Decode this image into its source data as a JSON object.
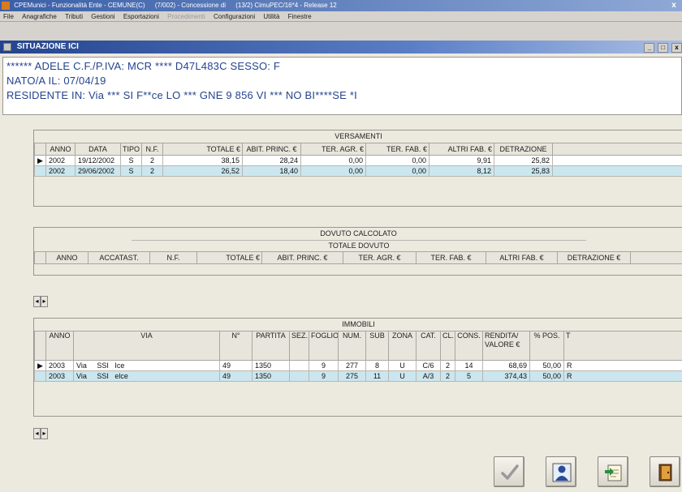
{
  "app": {
    "title_segments": [
      "CPEMunici - Funzionalità Ente - CEMUNE(C)",
      "(7/002) - Concessione di",
      "(13/2) CimuPEC/16*4 - Release 12"
    ],
    "menu": [
      {
        "label": "File",
        "disabled": false
      },
      {
        "label": "Anagrafiche",
        "disabled": false
      },
      {
        "label": "Tributi",
        "disabled": false
      },
      {
        "label": "Gestioni",
        "disabled": false
      },
      {
        "label": "Esportazioni",
        "disabled": false
      },
      {
        "label": "Procedimenti",
        "disabled": true
      },
      {
        "label": "Configurazioni",
        "disabled": false
      },
      {
        "label": "Utilità",
        "disabled": false
      },
      {
        "label": "Finestre",
        "disabled": false
      }
    ]
  },
  "window": {
    "title": "SITUAZIONE ICI",
    "controls": [
      "_",
      "□",
      "x"
    ]
  },
  "person": {
    "line1": "****** ADELE     C.F./P.IVA: MCR **** D47L483C     SESSO: F",
    "line2": "NATO/A IL: 07/04/19",
    "line3": "RESIDENTE IN: Via     *** SI F**ce LO *** GNE  9     856 VI *** NO BI****SE *I"
  },
  "versamenti": {
    "title": "VERSAMENTI",
    "columns": [
      "ANNO",
      "DATA",
      "TIPO",
      "N.F.",
      "TOTALE €",
      "ABIT. PRINC. €",
      "TER. AGR. €",
      "TER. FAB. €",
      "ALTRI FAB. €",
      "DETRAZIONE"
    ],
    "rows": [
      {
        "anno": "2002",
        "data": "19/12/2002",
        "tipo": "S",
        "nf": "2",
        "totale": "38,15",
        "abit": "28,24",
        "ter_agr": "0,00",
        "ter_fab": "0,00",
        "altri": "9,91",
        "detrazione": "25,82"
      },
      {
        "anno": "2002",
        "data": "29/06/2002",
        "tipo": "S",
        "nf": "2",
        "totale": "26,52",
        "abit": "18,40",
        "ter_agr": "0,00",
        "ter_fab": "0,00",
        "altri": "8,12",
        "detrazione": "25,83"
      }
    ]
  },
  "dovuto": {
    "title": "DOVUTO CALCOLATO",
    "subtitle": "TOTALE DOVUTO",
    "columns": [
      "ANNO",
      "ACCATAST.",
      "N.F.",
      "TOTALE €",
      "ABIT. PRINC. €",
      "TER. AGR. €",
      "TER. FAB. €",
      "ALTRI FAB. €",
      "DETRAZIONE €"
    ]
  },
  "immobili": {
    "title": "IMMOBILI",
    "columns": [
      "ANNO",
      "VIA",
      "N°",
      "PARTITA",
      "SEZ.",
      "FOGLIO",
      "NUM.",
      "SUB",
      "ZONA",
      "CAT.",
      "CL.",
      "CONS.",
      "RENDITA/ VALORE €",
      "% POS.",
      "T"
    ],
    "rows": [
      {
        "anno": "2003",
        "via": "Via     SSI   Ice",
        "n": "49",
        "partita": "1350",
        "sez": "",
        "foglio": "9",
        "num": "277",
        "sub": "8",
        "zona": "U",
        "cat": "C/6",
        "cl": "2",
        "cons": "14",
        "rendita": "68,69",
        "pos": "50,00",
        "t": "R"
      },
      {
        "anno": "2003",
        "via": "Via     SSI   elce",
        "n": "49",
        "partita": "1350",
        "sez": "",
        "foglio": "9",
        "num": "275",
        "sub": "11",
        "zona": "U",
        "cat": "A/3",
        "cl": "2",
        "cons": "5",
        "rendita": "374,43",
        "pos": "50,00",
        "t": "R"
      }
    ]
  },
  "row_marker": "▶",
  "scroll_arrows": {
    "left": "◂",
    "right": "▸"
  },
  "toolbar": {
    "buttons": [
      {
        "icon": "check-icon"
      },
      {
        "icon": "user-icon"
      },
      {
        "icon": "document-icon"
      },
      {
        "icon": "exit-door-icon"
      }
    ]
  },
  "colors": {
    "title_blue": "#24448e",
    "selected_row": "#ffffff",
    "alt_row": "#cbe6ee",
    "panel_bg": "#ece9df"
  }
}
